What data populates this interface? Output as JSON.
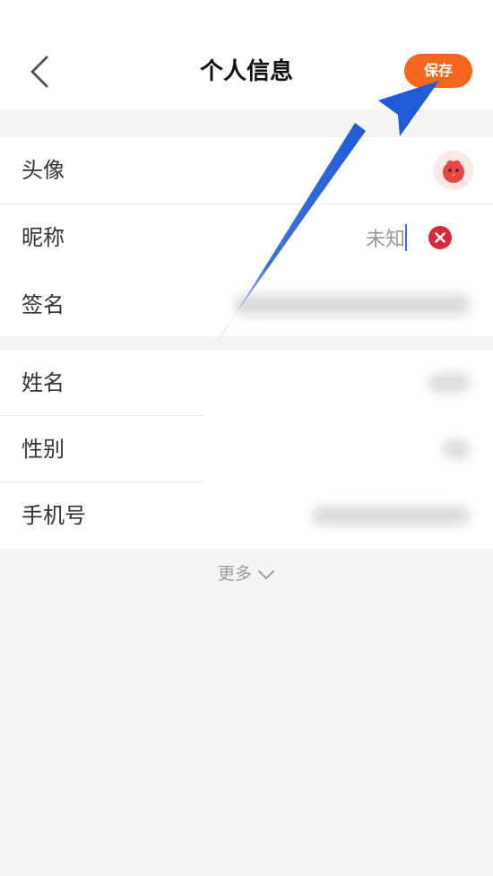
{
  "header": {
    "title": "个人信息",
    "save_label": "保存"
  },
  "rows": {
    "avatar_label": "头像",
    "nickname_label": "昵称",
    "nickname_value": "未知",
    "signature_label": "签名",
    "name_label": "姓名",
    "gender_label": "性别",
    "phone_label": "手机号"
  },
  "more_label": "更多",
  "colors": {
    "accent": "#f2661e",
    "clear": "#d8283a",
    "annotation_arrow": "#1e5bd6",
    "background": "#f4f4f4"
  },
  "icons": {
    "back": "chevron-left-icon",
    "clear": "clear-icon",
    "more": "chevron-down-icon"
  }
}
